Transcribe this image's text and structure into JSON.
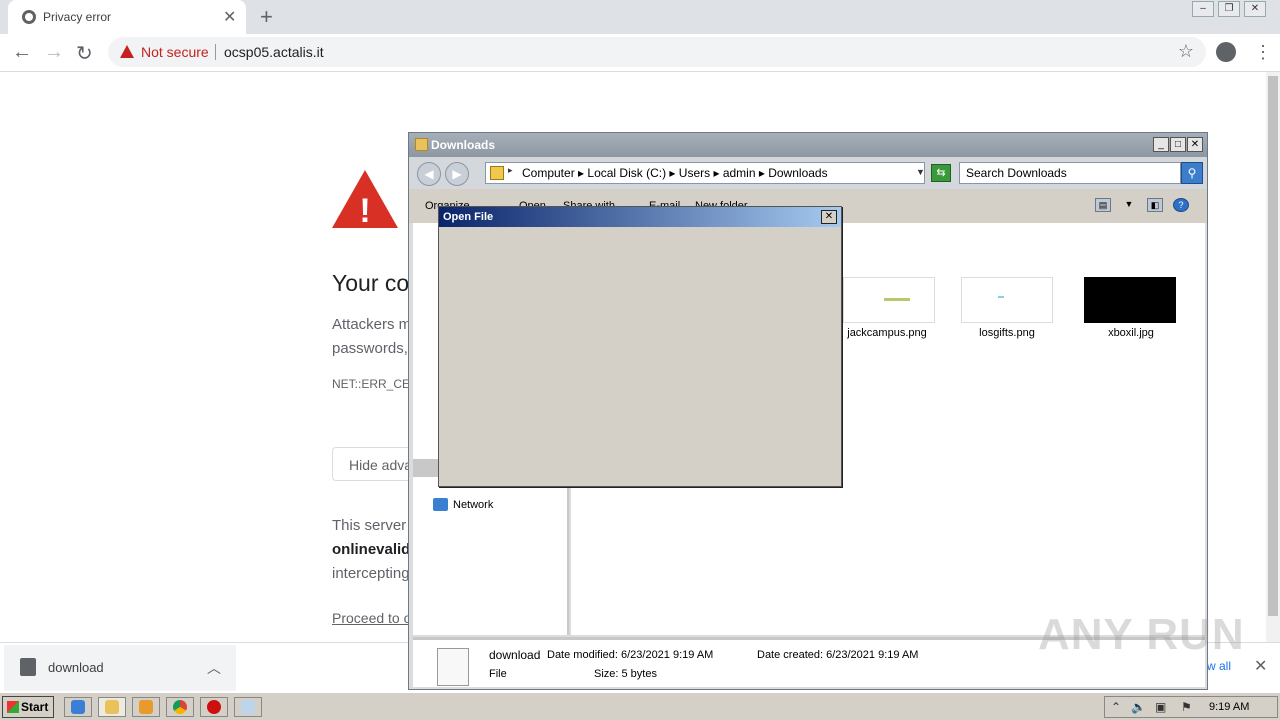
{
  "browser": {
    "tab_title": "Privacy error",
    "security_label": "Not secure",
    "url": "ocsp05.actalis.it"
  },
  "error_page": {
    "heading": "Your co",
    "para1_line1": "Attackers m",
    "para1_line2": "passwords,",
    "error_code": "NET::ERR_CEF",
    "hide_button": "Hide adva",
    "para2_line1": "This server c",
    "para2_line2": "onlinevalid",
    "para2_line3": "intercepting",
    "proceed_link": "Proceed to o"
  },
  "download_bar": {
    "item_name": "download",
    "show_all": "w all"
  },
  "explorer": {
    "title": "Downloads",
    "breadcrumb": [
      "Computer",
      "Local Disk (C:)",
      "Users",
      "admin",
      "Downloads"
    ],
    "search_placeholder": "Search Downloads",
    "commands": [
      "Organize",
      "Open",
      "Share with",
      "E-mail",
      "New folder"
    ],
    "nav_network": "Network",
    "files": [
      {
        "name": "jackcampus.png"
      },
      {
        "name": "losgifts.png"
      },
      {
        "name": "xboxil.jpg"
      }
    ],
    "details": {
      "name": "download",
      "type": "File",
      "date_modified": "Date modified: 6/23/2021 9:19 AM",
      "size": "Size: 5 bytes",
      "date_created": "Date created: 6/23/2021 9:19 AM"
    }
  },
  "dialog": {
    "title": "Open File"
  },
  "taskbar": {
    "start_label": "Start",
    "clock": "9:19 AM"
  },
  "watermark": "ANY RUN",
  "colors": {
    "danger": "#d93025",
    "chrome_tabstrip": "#dee1e6",
    "dialog_title_start": "#0a246a",
    "dialog_title_end": "#a6caf0"
  }
}
